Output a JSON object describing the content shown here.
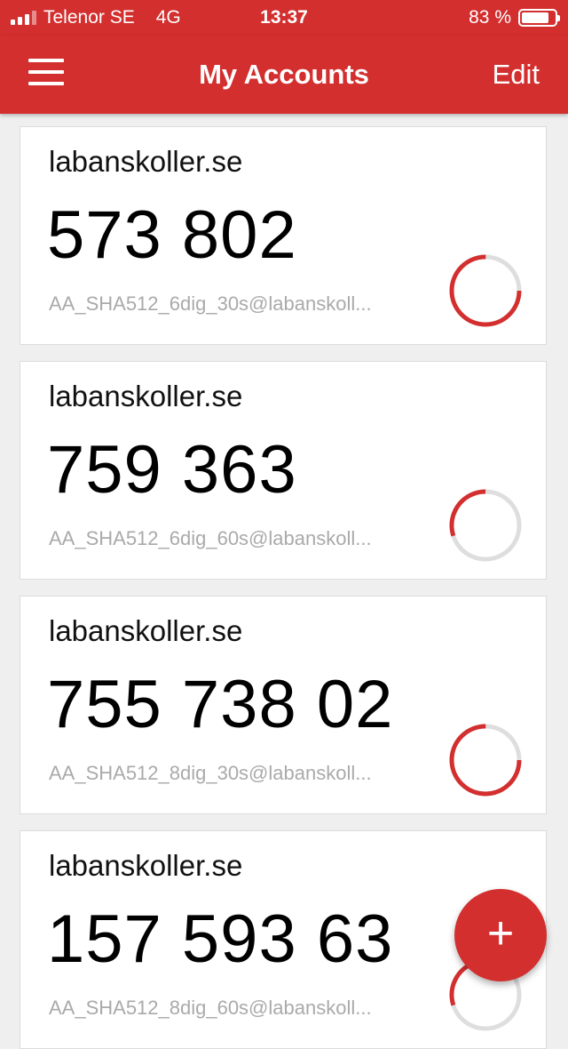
{
  "status_bar": {
    "carrier": "Telenor SE",
    "network": "4G",
    "time": "13:37",
    "battery_text": "83 %",
    "battery_level": 0.83
  },
  "header": {
    "title": "My Accounts",
    "edit_label": "Edit",
    "menu_icon": "hamburger-menu-icon"
  },
  "colors": {
    "accent": "#d32f2f",
    "background": "#efefef",
    "ring_track": "#dedede"
  },
  "accounts": [
    {
      "issuer": "labanskoller.se",
      "code": "573 802",
      "label": "AA_SHA512_6dig_30s@labanskoll...",
      "remaining": 0.75
    },
    {
      "issuer": "labanskoller.se",
      "code": "759 363",
      "label": "AA_SHA512_6dig_60s@labanskoll...",
      "remaining": 0.3
    },
    {
      "issuer": "labanskoller.se",
      "code": "755 738 02",
      "label": "AA_SHA512_8dig_30s@labanskoll...",
      "remaining": 0.75
    },
    {
      "issuer": "labanskoller.se",
      "code": "157 593 63",
      "label": "AA_SHA512_8dig_60s@labanskoll...",
      "remaining": 0.3
    }
  ],
  "fab": {
    "icon": "plus-icon",
    "label": "+"
  }
}
